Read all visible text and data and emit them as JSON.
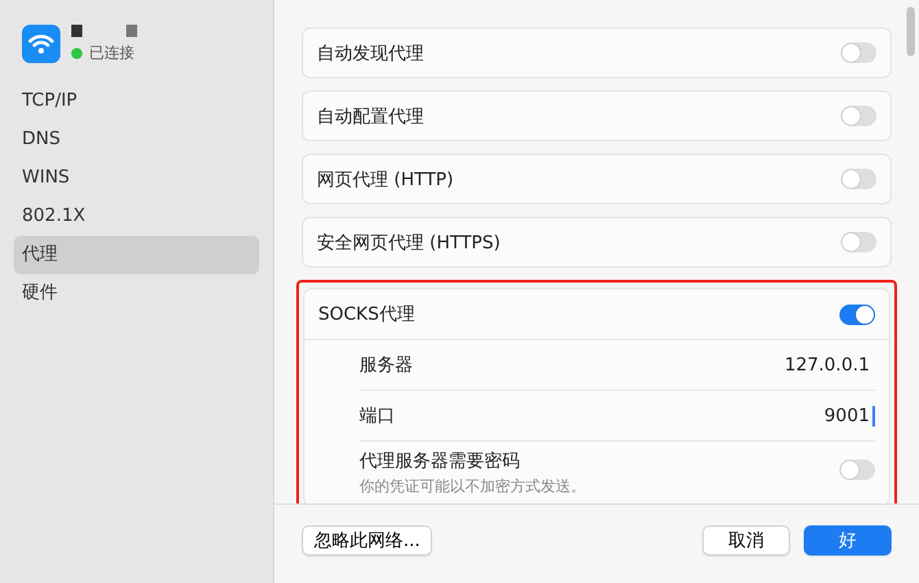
{
  "sidebar": {
    "network": {
      "status": "已连接",
      "connected": true
    },
    "items": [
      {
        "label": "TCP/IP",
        "selected": false
      },
      {
        "label": "DNS",
        "selected": false
      },
      {
        "label": "WINS",
        "selected": false
      },
      {
        "label": "802.1X",
        "selected": false
      },
      {
        "label": "代理",
        "selected": true
      },
      {
        "label": "硬件",
        "selected": false
      }
    ]
  },
  "proxies": [
    {
      "label": "自动发现代理",
      "on": false
    },
    {
      "label": "自动配置代理",
      "on": false
    },
    {
      "label": "网页代理 (HTTP)",
      "on": false
    },
    {
      "label": "安全网页代理 (HTTPS)",
      "on": false
    }
  ],
  "socks": {
    "label": "SOCKS代理",
    "on": true,
    "highlighted": true,
    "rows": [
      {
        "kind": "field",
        "label": "服务器",
        "value": "127.0.0.1",
        "focused": false
      },
      {
        "kind": "field",
        "label": "端口",
        "value": "9001",
        "focused": true
      },
      {
        "kind": "toggle",
        "label": "代理服务器需要密码",
        "on": false,
        "note": "你的凭证可能以不加密方式发送。"
      }
    ]
  },
  "footer": {
    "left_buttons": [
      {
        "label": "忽略此网络..."
      }
    ],
    "right_buttons": [
      {
        "label": "取消",
        "kind": "plain"
      },
      {
        "label": "好",
        "kind": "primary"
      }
    ]
  }
}
